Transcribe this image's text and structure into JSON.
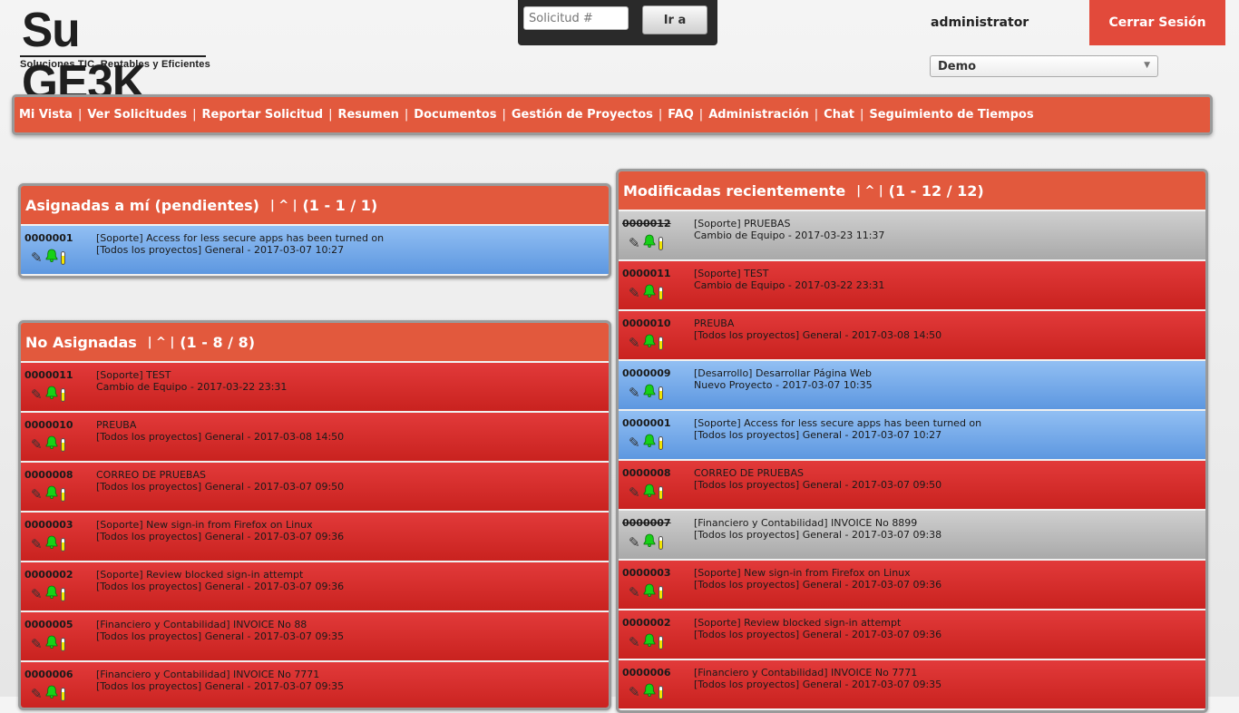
{
  "header": {
    "logo_main": "Su GE3K",
    "logo_tagline": "Soluciones TIC, Rentables y Eficientes",
    "search_placeholder": "Solicitud #",
    "search_button": "Ir a",
    "username": "administrator",
    "logout_label": "Cerrar Sesión",
    "project_selected": "Demo"
  },
  "nav": {
    "items": [
      {
        "label": "Mi Vista"
      },
      {
        "label": "Ver Solicitudes"
      },
      {
        "label": "Reportar Solicitud"
      },
      {
        "label": "Resumen"
      },
      {
        "label": "Documentos"
      },
      {
        "label": "Gestión de Proyectos"
      },
      {
        "label": "FAQ"
      },
      {
        "label": "Administración"
      },
      {
        "label": "Chat"
      },
      {
        "label": "Seguimiento de Tiempos"
      }
    ],
    "separator": "|"
  },
  "colors": {
    "accent": "#e2593d",
    "logout": "#e24a3b",
    "row_red": "#d52d2b",
    "row_blue": "#79acea",
    "row_gray": "#bdbdbd"
  },
  "icons": {
    "edit": "pencil-icon",
    "monitor": "bell-icon",
    "priority": "thermometer-icon"
  },
  "panels": {
    "assigned": {
      "title": "Asignadas a mí (pendientes)",
      "controls": "| ^ |",
      "count": "(1 - 1 / 1)",
      "rows": [
        {
          "id": "0000001",
          "line1": "[Soporte] Access for less secure apps has been turned on",
          "line2": "[Todos los proyectos] General - 2017-03-07 10:27",
          "status": "blue",
          "strike": false
        }
      ]
    },
    "unassigned": {
      "title": "No Asignadas",
      "controls": "| ^ |",
      "count": "(1 - 8 / 8)",
      "rows": [
        {
          "id": "0000011",
          "line1": "[Soporte] TEST",
          "line2": "Cambio de Equipo - 2017-03-22 23:31",
          "status": "red",
          "strike": false
        },
        {
          "id": "0000010",
          "line1": "PREUBA",
          "line2": "[Todos los proyectos] General - 2017-03-08 14:50",
          "status": "red",
          "strike": false
        },
        {
          "id": "0000008",
          "line1": "CORREO DE PRUEBAS",
          "line2": "[Todos los proyectos] General - 2017-03-07 09:50",
          "status": "red",
          "strike": false
        },
        {
          "id": "0000003",
          "line1": "[Soporte] New sign-in from Firefox on Linux",
          "line2": "[Todos los proyectos] General - 2017-03-07 09:36",
          "status": "red",
          "strike": false
        },
        {
          "id": "0000002",
          "line1": "[Soporte] Review blocked sign-in attempt",
          "line2": "[Todos los proyectos] General - 2017-03-07 09:36",
          "status": "red",
          "strike": false
        },
        {
          "id": "0000005",
          "line1": "[Financiero y Contabilidad] INVOICE No 88",
          "line2": "[Todos los proyectos] General - 2017-03-07 09:35",
          "status": "red",
          "strike": false
        },
        {
          "id": "0000006",
          "line1": "[Financiero y Contabilidad] INVOICE No 7771",
          "line2": "[Todos los proyectos] General - 2017-03-07 09:35",
          "status": "red",
          "strike": false
        }
      ]
    },
    "recent": {
      "title": "Modificadas recientemente",
      "controls": "| ^ |",
      "count": "(1 - 12 / 12)",
      "rows": [
        {
          "id": "0000012",
          "line1": "[Soporte] PRUEBAS",
          "line2": "Cambio de Equipo - 2017-03-23 11:37",
          "status": "gray",
          "strike": true
        },
        {
          "id": "0000011",
          "line1": "[Soporte] TEST",
          "line2": "Cambio de Equipo - 2017-03-22 23:31",
          "status": "red",
          "strike": false
        },
        {
          "id": "0000010",
          "line1": "PREUBA",
          "line2": "[Todos los proyectos] General - 2017-03-08 14:50",
          "status": "red",
          "strike": false
        },
        {
          "id": "0000009",
          "line1": "[Desarrollo] Desarrollar Página Web",
          "line2": "Nuevo Proyecto - 2017-03-07 10:35",
          "status": "blue",
          "strike": false
        },
        {
          "id": "0000001",
          "line1": "[Soporte] Access for less secure apps has been turned on",
          "line2": "[Todos los proyectos] General - 2017-03-07 10:27",
          "status": "blue",
          "strike": false
        },
        {
          "id": "0000008",
          "line1": "CORREO DE PRUEBAS",
          "line2": "[Todos los proyectos] General - 2017-03-07 09:50",
          "status": "red",
          "strike": false
        },
        {
          "id": "0000007",
          "line1": "[Financiero y Contabilidad] INVOICE No 8899",
          "line2": "[Todos los proyectos] General - 2017-03-07 09:38",
          "status": "gray",
          "strike": true
        },
        {
          "id": "0000003",
          "line1": "[Soporte] New sign-in from Firefox on Linux",
          "line2": "[Todos los proyectos] General - 2017-03-07 09:36",
          "status": "red",
          "strike": false
        },
        {
          "id": "0000002",
          "line1": "[Soporte] Review blocked sign-in attempt",
          "line2": "[Todos los proyectos] General - 2017-03-07 09:36",
          "status": "red",
          "strike": false
        },
        {
          "id": "0000006",
          "line1": "[Financiero y Contabilidad] INVOICE No 7771",
          "line2": "[Todos los proyectos] General - 2017-03-07 09:35",
          "status": "red",
          "strike": false
        }
      ]
    }
  }
}
